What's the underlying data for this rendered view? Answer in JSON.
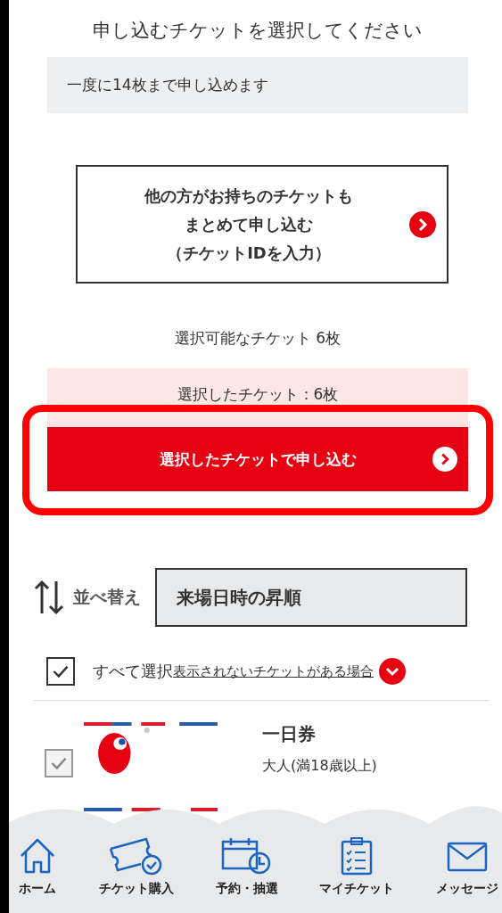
{
  "heading": "申し込むチケットを選択してください",
  "notice": "一度に14枚まで申し込めます",
  "other_tickets_button": {
    "lines": [
      "他の方がお持ちのチケットも",
      "まとめて申し込む",
      "（チケットIDを入力）"
    ]
  },
  "available_count": "選択可能なチケット 6枚",
  "selected_count": "選択したチケット：6枚",
  "apply_button": {
    "label": "選択したチケットで申し込む",
    "highlighted": true
  },
  "sort": {
    "label": "並べ替え",
    "value": "来場日時の昇順"
  },
  "select_all": {
    "label": "すべて選択",
    "checked": true,
    "link": "表示されないチケットがある場合"
  },
  "tickets": [
    {
      "kind": "picture",
      "name": "一日券",
      "category": "大人(満18歳以上)",
      "checked": true,
      "disabled": true
    }
  ],
  "nav": [
    {
      "kind": "home",
      "label": "ホーム"
    },
    {
      "kind": "ticket",
      "label": "チケット購入"
    },
    {
      "kind": "calendar",
      "label": "予約・抽選"
    },
    {
      "kind": "clipboard",
      "label": "マイチケット"
    },
    {
      "kind": "mail",
      "label": "メッセージ"
    }
  ]
}
